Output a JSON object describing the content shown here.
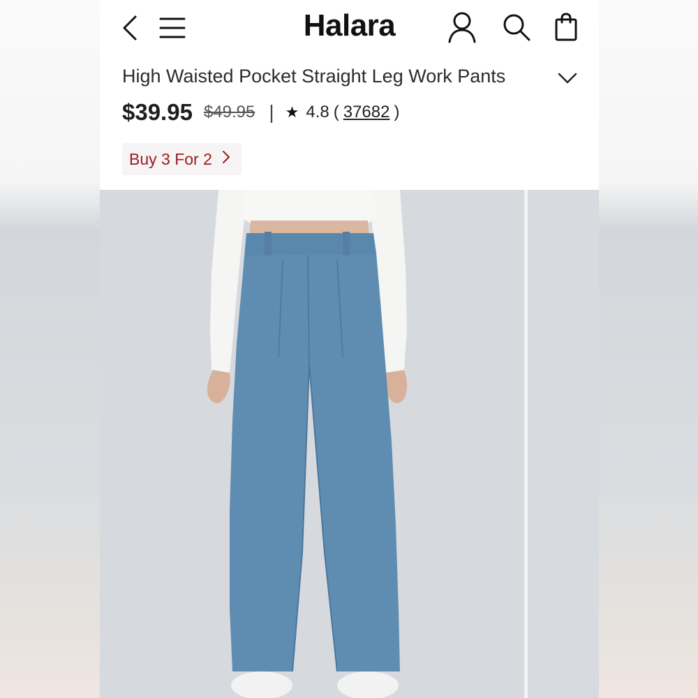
{
  "header": {
    "brand": "Halara",
    "icons": [
      "back-chevron-icon",
      "menu-icon",
      "account-icon",
      "search-icon",
      "shopping-bag-icon"
    ]
  },
  "product": {
    "title": "High Waisted Pocket Straight Leg Work Pants",
    "price": "$39.95",
    "original_price": "$49.95",
    "separator": "|",
    "rating": "4.8",
    "open_paren": "(",
    "review_count": "37682",
    "close_paren": ")"
  },
  "promo": {
    "label": "Buy 3 For 2"
  },
  "colors": {
    "promo_text": "#9b1b1f",
    "pants_blue": "#5f8db2",
    "top_white": "#f5f5f3",
    "image_bg": "#d6dade"
  }
}
